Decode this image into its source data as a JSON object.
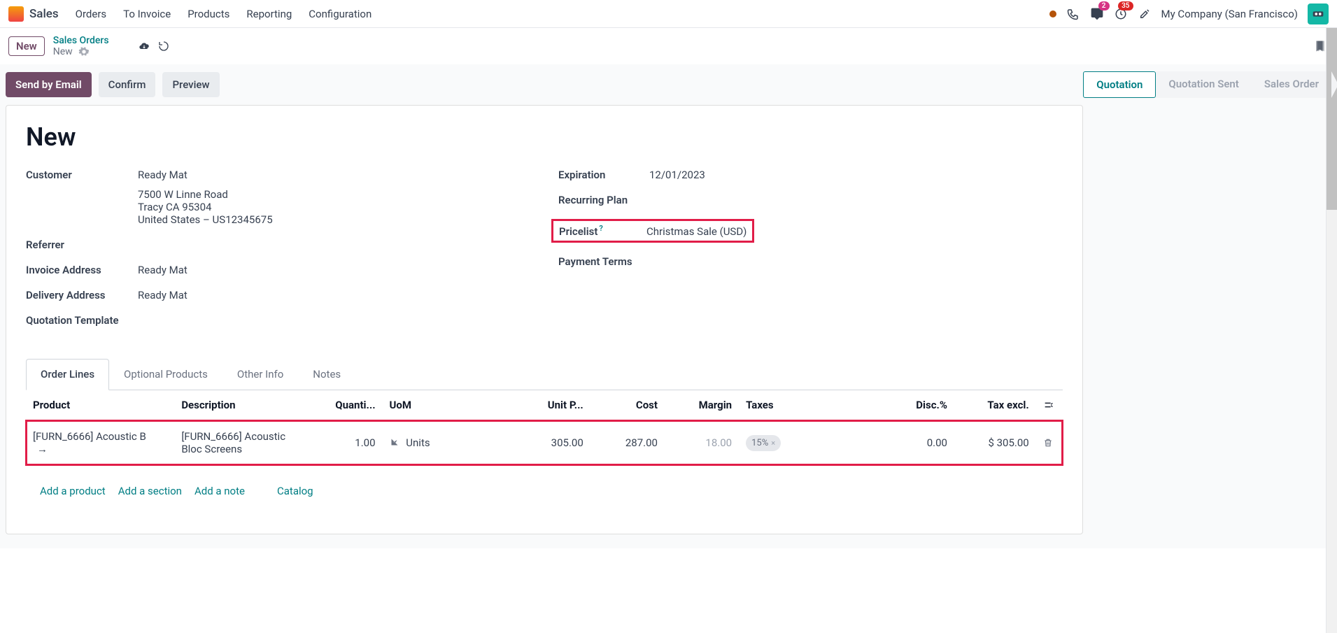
{
  "app_name": "Sales",
  "topnav": {
    "menu": [
      "Orders",
      "To Invoice",
      "Products",
      "Reporting",
      "Configuration"
    ],
    "chat_count": "2",
    "activity_count": "35",
    "company": "My Company (San Francisco)"
  },
  "controlbar": {
    "new_btn": "New",
    "breadcrumb_parent": "Sales Orders",
    "breadcrumb_current": "New"
  },
  "actions": {
    "send_by_email": "Send by Email",
    "confirm": "Confirm",
    "preview": "Preview"
  },
  "status": {
    "quotation": "Quotation",
    "quotation_sent": "Quotation Sent",
    "sales_order": "Sales Order"
  },
  "sheet": {
    "title": "New",
    "left": {
      "customer_label": "Customer",
      "customer_name": "Ready Mat",
      "customer_addr1": "7500 W Linne Road",
      "customer_addr2": "Tracy CA 95304",
      "customer_addr3": "United States – US12345675",
      "referrer_label": "Referrer",
      "invoice_label": "Invoice Address",
      "invoice_value": "Ready Mat",
      "delivery_label": "Delivery Address",
      "delivery_value": "Ready Mat",
      "template_label": "Quotation Template"
    },
    "right": {
      "expiration_label": "Expiration",
      "expiration_value": "12/01/2023",
      "recurring_label": "Recurring Plan",
      "pricelist_label": "Pricelist",
      "pricelist_value": "Christmas Sale (USD)",
      "payment_label": "Payment Terms"
    }
  },
  "tabs": {
    "order_lines": "Order Lines",
    "optional": "Optional Products",
    "other": "Other Info",
    "notes": "Notes"
  },
  "table": {
    "headers": {
      "product": "Product",
      "description": "Description",
      "quantity": "Quanti...",
      "uom": "UoM",
      "unit_price": "Unit P...",
      "cost": "Cost",
      "margin": "Margin",
      "taxes": "Taxes",
      "discount": "Disc.%",
      "tax_excl": "Tax excl."
    },
    "row": {
      "product": "[FURN_6666] Acoustic B",
      "description": "[FURN_6666] Acoustic Bloc Screens",
      "quantity": "1.00",
      "uom": "Units",
      "unit_price": "305.00",
      "cost": "287.00",
      "margin": "18.00",
      "tax": "15%",
      "discount": "0.00",
      "tax_excl": "$ 305.00"
    },
    "actions": {
      "add_product": "Add a product",
      "add_section": "Add a section",
      "add_note": "Add a note",
      "catalog": "Catalog"
    }
  }
}
